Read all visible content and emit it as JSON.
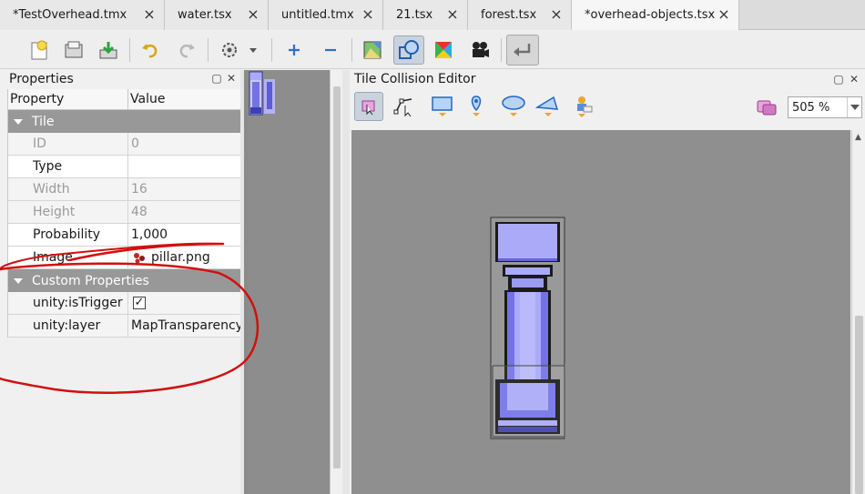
{
  "tabs": [
    {
      "label": "*TestOverhead.tmx",
      "active": false
    },
    {
      "label": "water.tsx",
      "active": false
    },
    {
      "label": "untitled.tmx",
      "active": false
    },
    {
      "label": "21.tsx",
      "active": false
    },
    {
      "label": "forest.tsx",
      "active": false
    },
    {
      "label": "*overhead-objects.tsx",
      "active": true
    }
  ],
  "tab_close_glyph": "×",
  "toolbar": {
    "icons": [
      "new-tileset-icon",
      "open-icon",
      "save-icon",
      "undo-icon",
      "redo-icon",
      "settings-icon",
      "add-icon",
      "remove-icon",
      "terrain-icon",
      "collision-icon",
      "wang-icon",
      "animation-icon",
      "back-icon"
    ]
  },
  "properties": {
    "title": "Properties",
    "header": {
      "property": "Property",
      "value": "Value"
    },
    "tile_group": {
      "label": "Tile",
      "rows": [
        {
          "name": "ID",
          "value": "0",
          "readonly": true
        },
        {
          "name": "Type",
          "value": "",
          "readonly": false
        },
        {
          "name": "Width",
          "value": "16",
          "readonly": true
        },
        {
          "name": "Height",
          "value": "48",
          "readonly": true
        },
        {
          "name": "Probability",
          "value": "1,000",
          "readonly": false
        },
        {
          "name": "Image",
          "value": "pillar.png",
          "readonly": false
        }
      ]
    },
    "custom_group": {
      "label": "Custom Properties",
      "rows": [
        {
          "name": "unity:isTrigger",
          "value": "✓",
          "type": "checkbox"
        },
        {
          "name": "unity:layer",
          "value": "MapTransparency",
          "type": "text"
        }
      ]
    }
  },
  "collision_editor": {
    "title": "Tile Collision Editor",
    "tools": [
      "select-objects-icon",
      "edit-polygons-icon",
      "rectangle-icon",
      "point-icon",
      "ellipse-icon",
      "polygon-icon",
      "template-icon"
    ],
    "zoom": "505 %"
  },
  "panel_buttons": {
    "float": "▢",
    "close": "✕"
  },
  "colors": {
    "tile_light": "#aaaaf8",
    "tile_mid": "#7373e6",
    "tile_dark": "#3f3fb4",
    "annotation": "#d20f0f",
    "group_bg": "#989898"
  }
}
